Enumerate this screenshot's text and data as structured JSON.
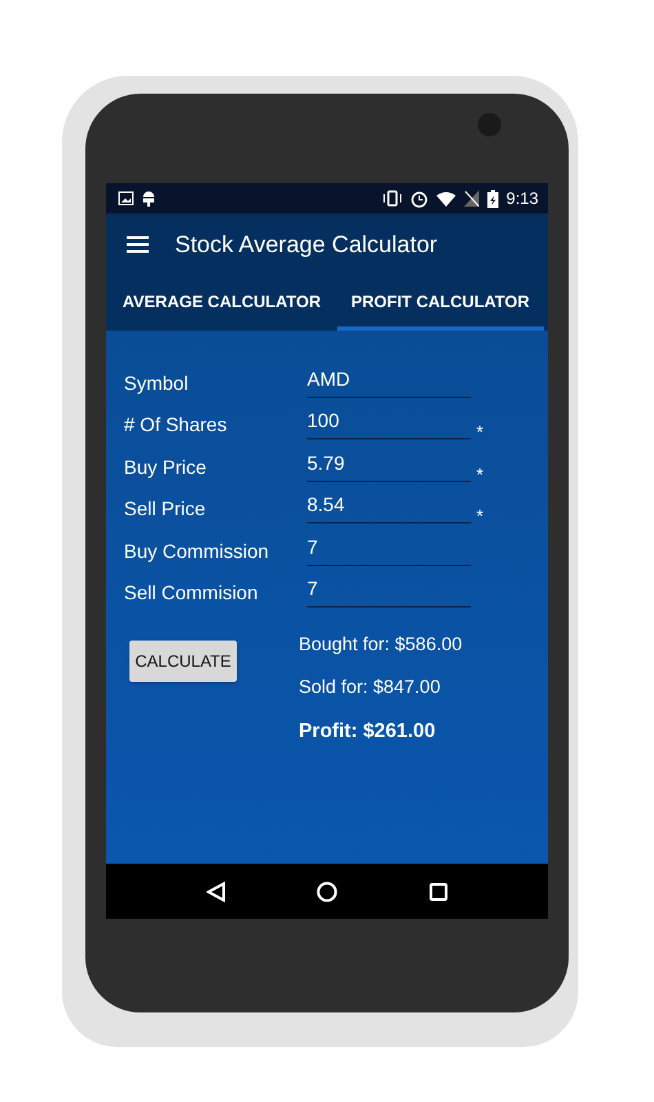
{
  "status_bar": {
    "time": "9:13"
  },
  "app_bar": {
    "title": "Stock Average Calculator"
  },
  "tabs": [
    {
      "label": "AVERAGE CALCULATOR",
      "selected": false
    },
    {
      "label": "PROFIT CALCULATOR",
      "selected": true
    }
  ],
  "fields": [
    {
      "label": "Symbol",
      "value": "AMD"
    },
    {
      "label": "# Of Shares",
      "value": "100",
      "mark": "*"
    },
    {
      "label": "Buy Price",
      "value": "5.79",
      "mark": "*"
    },
    {
      "label": "Sell Price",
      "value": "8.54",
      "mark": "*"
    },
    {
      "label": "Buy Commission",
      "value": "7"
    },
    {
      "label": "Sell Commision",
      "value": "7"
    }
  ],
  "calculate_button": "CALCULATE",
  "results": [
    {
      "text": "Bought for: $586.00",
      "kind": "normal"
    },
    {
      "text": "Sold for: $847.00",
      "kind": "normal"
    },
    {
      "text": "Profit: $261.00",
      "kind": "total"
    }
  ]
}
